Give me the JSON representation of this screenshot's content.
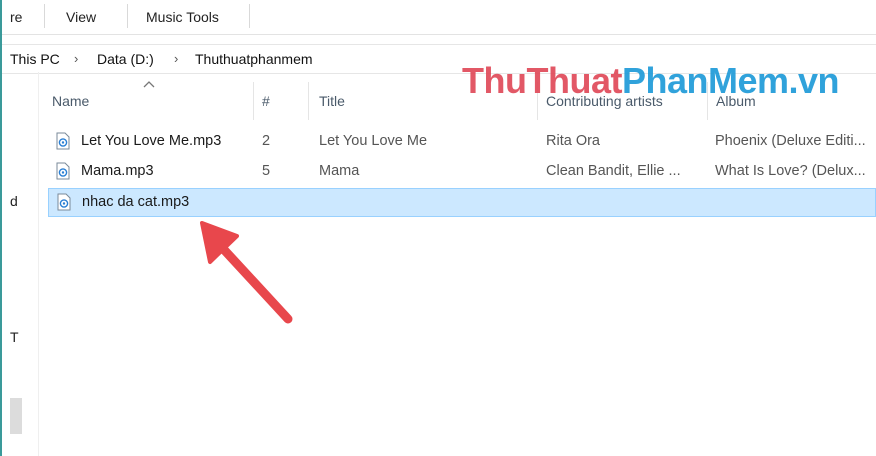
{
  "ribbon": {
    "tabs": [
      "re",
      "View",
      "Music Tools"
    ]
  },
  "breadcrumb": {
    "items": [
      "This PC",
      "Data (D:)",
      "Thuthuatphanmem"
    ]
  },
  "nav_fragments": [
    "d",
    "T"
  ],
  "columns": {
    "name": "Name",
    "number": "#",
    "title": "Title",
    "artists": "Contributing artists",
    "album": "Album"
  },
  "files": [
    {
      "name": "Let You Love Me.mp3",
      "number": "2",
      "title": "Let You Love Me",
      "artists": "Rita Ora",
      "album": "Phoenix (Deluxe Editi..."
    },
    {
      "name": "Mama.mp3",
      "number": "5",
      "title": "Mama",
      "artists": "Clean Bandit, Ellie ...",
      "album": "What Is Love? (Delux..."
    },
    {
      "name": "nhac da cat.mp3",
      "number": "",
      "title": "",
      "artists": "",
      "album": ""
    }
  ],
  "watermark": {
    "part1": "ThuThuat",
    "part2": "PhanMem.vn"
  },
  "colors": {
    "selection_bg": "#cce8ff",
    "selection_border": "#99d1ff",
    "arrow": "#e8474c",
    "watermark_red": "#e04a5a",
    "watermark_blue": "#1f9bd8"
  },
  "icons": {
    "file": "audio-file-icon",
    "sort": "sort-ascending-icon",
    "crumb_sep": "chevron-right-icon",
    "annotation": "red-arrow-annotation"
  }
}
